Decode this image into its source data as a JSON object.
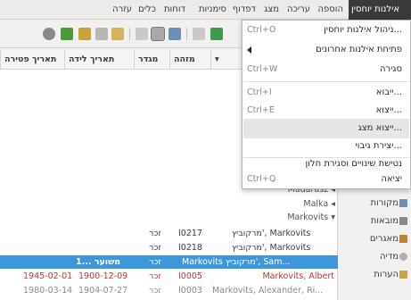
{
  "menubar": {
    "items": [
      {
        "label": "אילנות יוחסין",
        "active": true
      },
      {
        "label": "הוספה"
      },
      {
        "label": "עריכה"
      },
      {
        "label": "מצג"
      },
      {
        "label": "דפדוף"
      },
      {
        "label": "סימניות"
      },
      {
        "label": "דוחות"
      },
      {
        "label": "כלים"
      },
      {
        "label": "עזרה"
      }
    ]
  },
  "file_menu": {
    "items": [
      {
        "label": "ניהול אילנות יוחסין...",
        "shortcut": "Ctrl+O"
      },
      {
        "label": "פתיחת אילנות אחרונים",
        "shortcut": ""
      },
      {
        "label": "סגירה",
        "shortcut": "Ctrl+W"
      },
      {
        "label": "ייבוא...",
        "shortcut": "Ctrl+I"
      },
      {
        "label": "ייצוא...",
        "shortcut": "Ctrl+E"
      },
      {
        "label": "ייצוא מצג...",
        "shortcut": ""
      },
      {
        "label": "יצירת גיבוי...",
        "shortcut": ""
      },
      {
        "label": "נטישת שינויים וסגירת חלון",
        "shortcut": ""
      },
      {
        "label": "יציאה",
        "shortcut": "Ctrl+Q"
      }
    ]
  },
  "columns": {
    "id": "מזהה",
    "gender": "מגדר",
    "birth": "תאריך לידה",
    "death": "תאריך פטירה"
  },
  "tree_nodes": [
    {
      "label": "Madarász"
    },
    {
      "label": "Malka"
    },
    {
      "label": "Markovits"
    }
  ],
  "rows": [
    {
      "name": "מרקוביץ', Markovits",
      "id": "I0217",
      "gender": "זכר",
      "birth": "",
      "death": ""
    },
    {
      "name": "מרקוביץ', Markovits",
      "id": "I0218",
      "gender": "זכר",
      "birth": "",
      "death": ""
    },
    {
      "name": "Markovits מרקוביץ', Sam...",
      "id": "I0203",
      "gender": "זכר",
      "birth": "משוער ...1",
      "death": ""
    },
    {
      "name": "Markovits, Albert",
      "id": "I0005",
      "gender": "זכר",
      "birth": "1900-12-09",
      "death": "1945-02-01"
    },
    {
      "name": "Markovits, Alexander, Ri...",
      "id": "I0003",
      "gender": "זכר",
      "birth": "1904-07-27",
      "death": "1980-03-14"
    }
  ],
  "sidebar": {
    "items": [
      {
        "label": "מקורות",
        "icon": "sources-icon"
      },
      {
        "label": "מובאות",
        "icon": "citations-icon"
      },
      {
        "label": "מאגרים",
        "icon": "repositories-icon"
      },
      {
        "label": "מדיה",
        "icon": "media-icon"
      },
      {
        "label": "הערות",
        "icon": "notes-icon"
      }
    ]
  },
  "colors": {
    "selection": "#3d97d9",
    "menubar_active": "#3a3a3a",
    "red_text": "#c0362c"
  }
}
